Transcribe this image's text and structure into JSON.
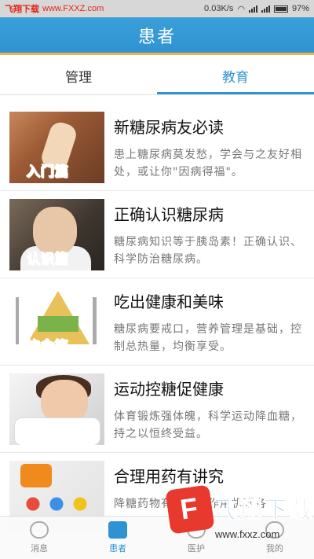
{
  "status_bar": {
    "watermark_text": "飞翔下载",
    "watermark_url": "www.FXXZ.com",
    "speed": "0.03K/s",
    "battery": "97%"
  },
  "header": {
    "title": "患者"
  },
  "tabs": [
    {
      "label": "管理",
      "active": false
    },
    {
      "label": "教育",
      "active": true
    }
  ],
  "articles": [
    {
      "badge": "入门篇",
      "title": "新糖尿病友必读",
      "desc": "患上糖尿病莫发愁，学会与之友好相处，或让你\"因病得福\"。"
    },
    {
      "badge": "认识篇",
      "title": "正确认识糖尿病",
      "desc": "糖尿病知识等于胰岛素！正确认识、科学防治糖尿病。"
    },
    {
      "badge": "饮食篇",
      "title": "吃出健康和美味",
      "desc": "糖尿病要戒口，营养管理是基础，控制总热量，均衡享受。"
    },
    {
      "badge": "运动篇",
      "title": "运动控糖促健康",
      "desc": "体育锻炼强体魄，科学运动降血糖，持之以恒终受益。"
    },
    {
      "badge": "",
      "title": "合理用药有讲究",
      "desc": "降糖药物有多种，作用机理各"
    }
  ],
  "bottom_nav": [
    {
      "label": "消息",
      "active": false
    },
    {
      "label": "患者",
      "active": true
    },
    {
      "label": "医护",
      "active": false
    },
    {
      "label": "我的",
      "active": false
    }
  ],
  "watermark": {
    "text": "飞翔下载",
    "url": "www.fxxz.com"
  },
  "colors": {
    "primary": "#2f93d2",
    "badge_red": "#ff2a2a"
  }
}
